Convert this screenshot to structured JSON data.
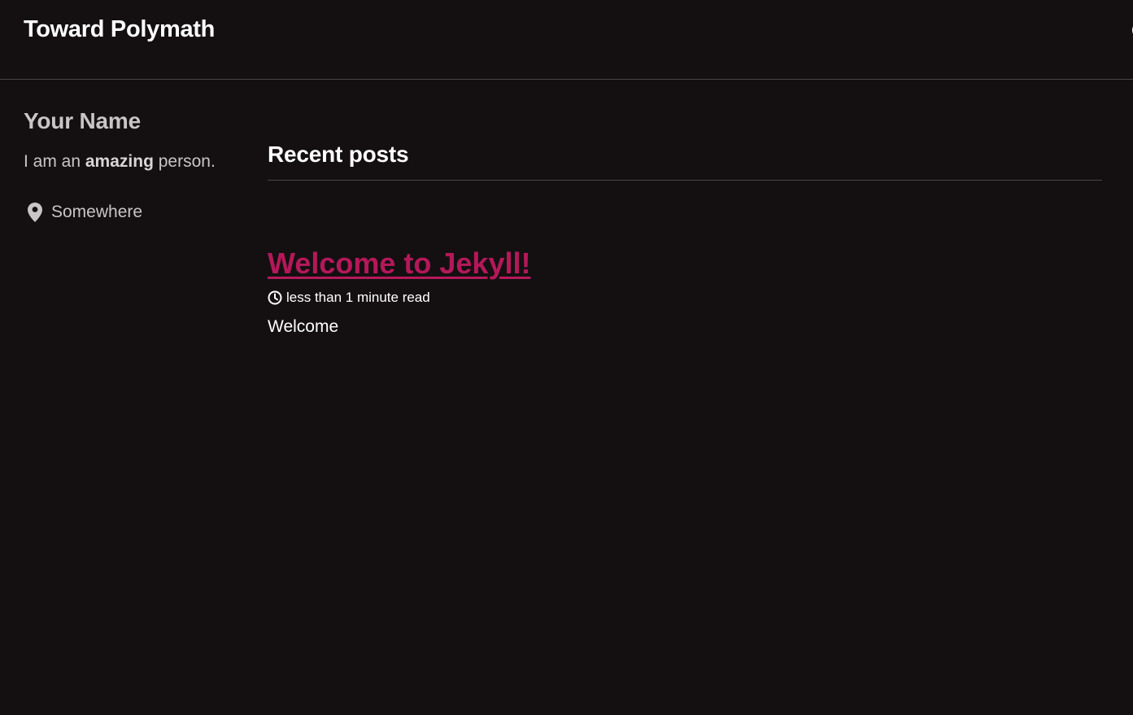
{
  "masthead": {
    "site_title": "Toward Polymath",
    "search_icon": "search-icon"
  },
  "sidebar": {
    "author_name": "Your Name",
    "bio_prefix": "I am an ",
    "bio_emphasis": "amazing",
    "bio_suffix": " person.",
    "location_icon": "map-marker-icon",
    "location": "Somewhere"
  },
  "main": {
    "section_title": "Recent posts",
    "posts": [
      {
        "title": "Welcome to Jekyll!",
        "read_time_icon": "clock-icon",
        "read_time": "less than 1 minute read",
        "excerpt": "Welcome"
      }
    ]
  },
  "colors": {
    "background": "#141011",
    "link_accent": "#b5185a",
    "sidebar_text": "#c9c4c5",
    "rule": "#4a4546"
  }
}
